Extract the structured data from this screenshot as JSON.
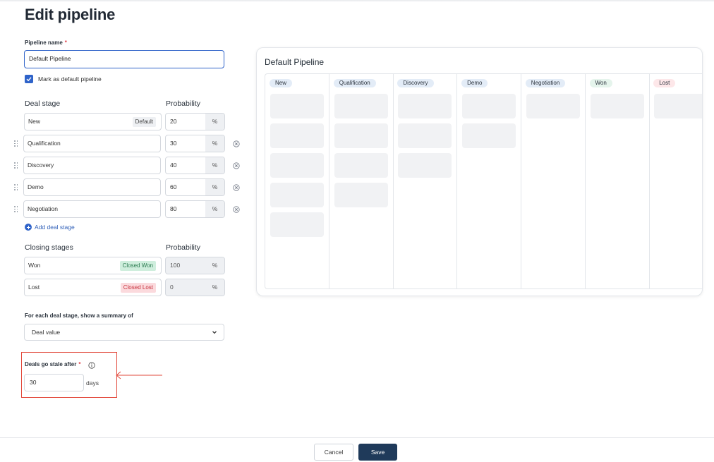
{
  "page": {
    "title": "Edit pipeline"
  },
  "pipeline_name": {
    "label": "Pipeline name",
    "required_mark": "*",
    "value": "Default Pipeline"
  },
  "default_checkbox": {
    "label": "Mark as default pipeline",
    "checked": true
  },
  "deal_stages": {
    "header": "Deal stage",
    "probability_header": "Probability",
    "items": [
      {
        "name": "New",
        "badge": "Default",
        "probability": "20",
        "unit": "%"
      },
      {
        "name": "Qualification",
        "probability": "30",
        "unit": "%"
      },
      {
        "name": "Discovery",
        "probability": "40",
        "unit": "%"
      },
      {
        "name": "Demo",
        "probability": "60",
        "unit": "%"
      },
      {
        "name": "Negotiation",
        "probability": "80",
        "unit": "%"
      }
    ],
    "add_label": "Add deal stage"
  },
  "closing_stages": {
    "header": "Closing stages",
    "probability_header": "Probability",
    "items": [
      {
        "name": "Won",
        "badge": "Closed Won",
        "probability": "100",
        "unit": "%"
      },
      {
        "name": "Lost",
        "badge": "Closed Lost",
        "probability": "0",
        "unit": "%"
      }
    ]
  },
  "summary": {
    "label": "For each deal stage, show a summary of",
    "value": "Deal value"
  },
  "stale": {
    "label": "Deals go stale after",
    "required_mark": "*",
    "value": "30",
    "unit": "days"
  },
  "preview": {
    "title": "Default Pipeline",
    "columns": [
      {
        "label": "New",
        "cards": 5,
        "tone": "blue"
      },
      {
        "label": "Qualification",
        "cards": 4,
        "tone": "blue"
      },
      {
        "label": "Discovery",
        "cards": 3,
        "tone": "blue"
      },
      {
        "label": "Demo",
        "cards": 2,
        "tone": "blue"
      },
      {
        "label": "Negotiation",
        "cards": 1,
        "tone": "blue"
      },
      {
        "label": "Won",
        "cards": 1,
        "tone": "green"
      },
      {
        "label": "Lost",
        "cards": 1,
        "tone": "red"
      }
    ]
  },
  "footer": {
    "cancel_label": "Cancel",
    "save_label": "Save"
  },
  "colors": {
    "accent": "#2f63c9",
    "save": "#1f3a5a",
    "highlight": "#e2483b"
  }
}
